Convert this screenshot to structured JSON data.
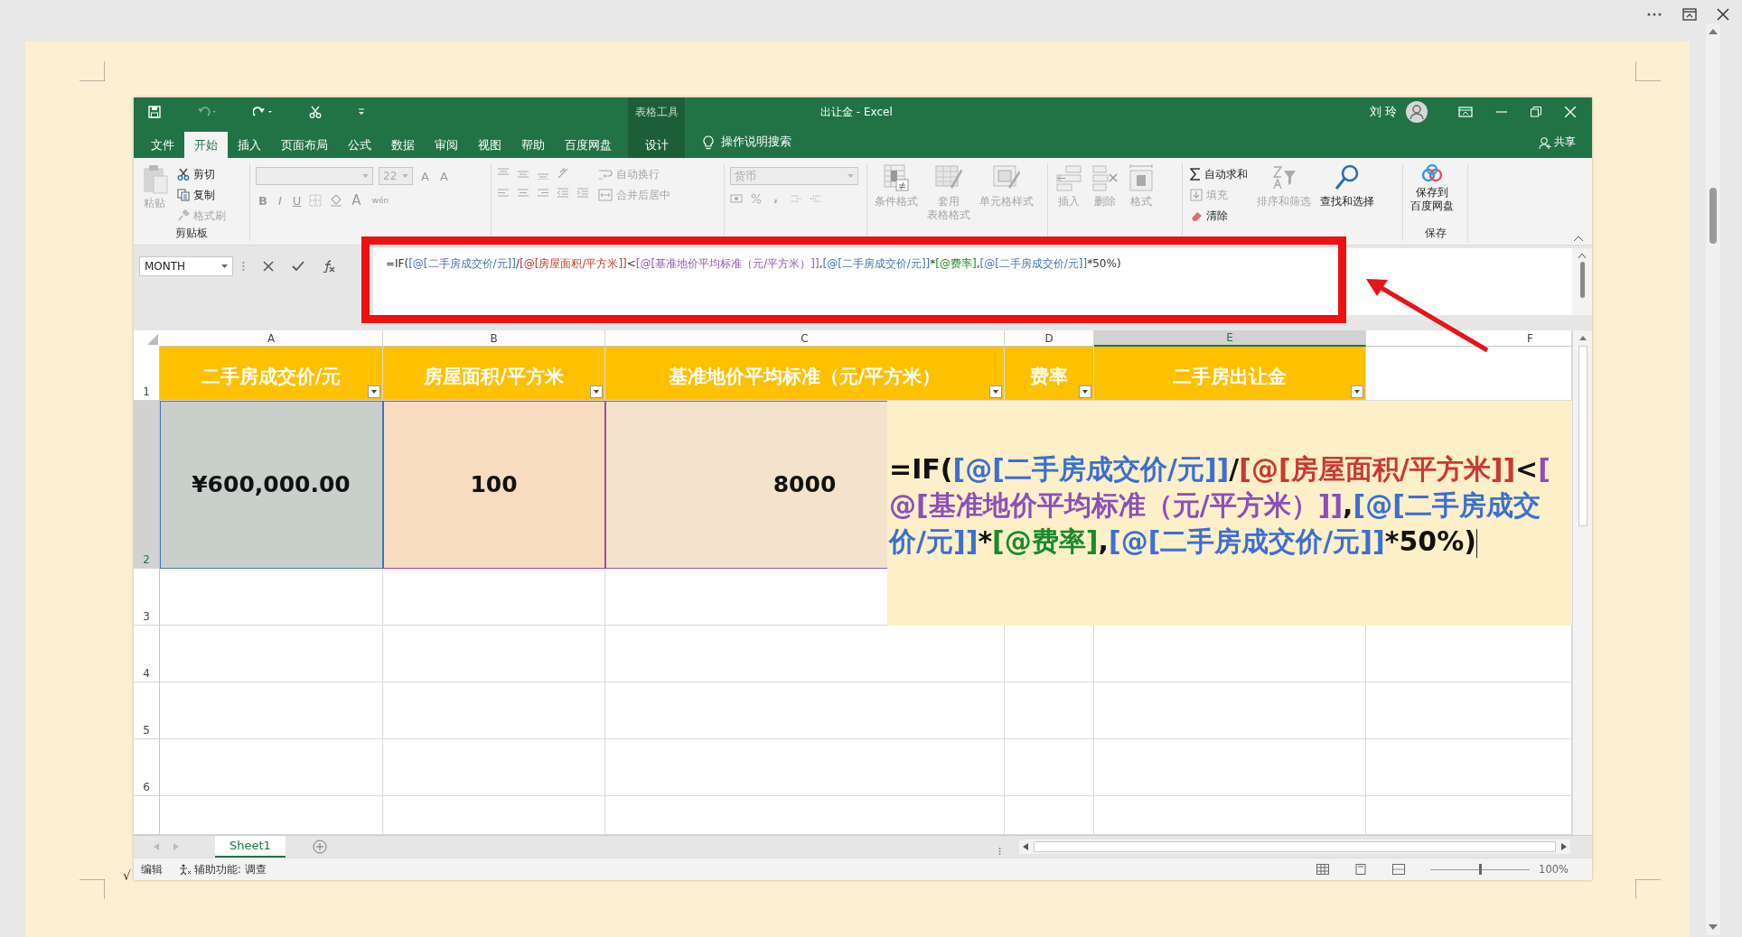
{
  "page": {
    "margin_mark": "√"
  },
  "excel": {
    "contextual_label": "表格工具",
    "title": "出让金 - Excel",
    "user": "刘 玲",
    "tabs": [
      {
        "label": "文件",
        "selected": false,
        "contextual": false
      },
      {
        "label": "开始",
        "selected": true,
        "contextual": false
      },
      {
        "label": "插入",
        "selected": false,
        "contextual": false
      },
      {
        "label": "页面布局",
        "selected": false,
        "contextual": false
      },
      {
        "label": "公式",
        "selected": false,
        "contextual": false
      },
      {
        "label": "数据",
        "selected": false,
        "contextual": false
      },
      {
        "label": "审阅",
        "selected": false,
        "contextual": false
      },
      {
        "label": "视图",
        "selected": false,
        "contextual": false
      },
      {
        "label": "帮助",
        "selected": false,
        "contextual": false
      },
      {
        "label": "百度网盘",
        "selected": false,
        "contextual": false
      },
      {
        "label": "设计",
        "selected": false,
        "contextual": true
      }
    ],
    "tell_me": "操作说明搜索",
    "share": "共享",
    "ribbon": {
      "groups": [
        {
          "kind": "clipboard",
          "label": "剪贴板",
          "items": [
            {
              "kind": "large",
              "lines": [
                "粘贴"
              ],
              "disabled": true
            },
            {
              "kind": "small",
              "label": "剪切",
              "disabled": false
            },
            {
              "kind": "small",
              "label": "复制",
              "disabled": false
            },
            {
              "kind": "small",
              "label": "格式刷",
              "disabled": true
            }
          ]
        },
        {
          "kind": "font",
          "size": "22",
          "format_buttons": [
            "B",
            "I",
            "U"
          ],
          "grow_buttons": [
            "A",
            "A"
          ],
          "color_button": "A",
          "phonetic": "wén"
        },
        {
          "kind": "alignment",
          "items": [
            {
              "kind": "small",
              "label": "自动换行",
              "disabled": true
            },
            {
              "kind": "small",
              "label": "合并后居中",
              "disabled": true
            }
          ]
        },
        {
          "kind": "number",
          "format": "货币"
        },
        {
          "kind": "styles",
          "items": [
            {
              "kind": "large",
              "lines": [
                "条件格式"
              ],
              "disabled": true
            },
            {
              "kind": "large",
              "lines": [
                "套用",
                "表格格式"
              ],
              "disabled": true
            },
            {
              "kind": "large",
              "lines": [
                "单元格样式"
              ],
              "disabled": true
            }
          ]
        },
        {
          "kind": "cells",
          "items": [
            {
              "kind": "large",
              "lines": [
                "插入"
              ],
              "disabled": true
            },
            {
              "kind": "large",
              "lines": [
                "删除"
              ],
              "disabled": true
            },
            {
              "kind": "large",
              "lines": [
                "格式"
              ],
              "disabled": true
            }
          ]
        },
        {
          "kind": "editing",
          "items": [
            {
              "kind": "small",
              "label": "自动求和",
              "disabled": false
            },
            {
              "kind": "small",
              "label": "填充",
              "disabled": true
            },
            {
              "kind": "small",
              "label": "清除",
              "disabled": false
            },
            {
              "kind": "large",
              "lines": [
                "排序和筛选"
              ],
              "disabled": true
            },
            {
              "kind": "large",
              "lines": [
                "查找和选择"
              ],
              "disabled": false
            }
          ]
        },
        {
          "kind": "save",
          "label": "保存",
          "items": [
            {
              "kind": "large",
              "lines": [
                "保存到",
                "百度网盘"
              ],
              "disabled": false
            }
          ]
        }
      ]
    },
    "formula_bar": {
      "name_box": "MONTH",
      "segments": [
        {
          "text": "=IF("
        },
        {
          "text": "[@[二手房成交价/元]]",
          "color": "#4472c4"
        },
        {
          "text": "/"
        },
        {
          "text": "[@[房屋面积/平方米]]",
          "color": "#c0392b"
        },
        {
          "text": "<"
        },
        {
          "text": "[@[基准地价平均标准（元/平方米）]]",
          "color": "#8e5bb5"
        },
        {
          "text": ","
        },
        {
          "text": "[@[二手房成交价/元]]",
          "color": "#4472c4"
        },
        {
          "text": "*"
        },
        {
          "text": "[@费率]",
          "color": "#1f8a2e"
        },
        {
          "text": ","
        },
        {
          "text": "[@[二手房成交价/元]]",
          "color": "#4472c4"
        },
        {
          "text": "*50%)"
        }
      ]
    },
    "sheet": {
      "columns": [
        {
          "label": "A",
          "selected": false
        },
        {
          "label": "B",
          "selected": false
        },
        {
          "label": "C",
          "selected": false
        },
        {
          "label": "D",
          "selected": false
        },
        {
          "label": "E",
          "selected": true
        },
        {
          "label": "F",
          "selected": false
        }
      ],
      "rows": [
        {
          "label": "1",
          "kind": "header",
          "selected": false,
          "cells": [
            {
              "kind": "header",
              "text": "二手房成交价/元"
            },
            {
              "kind": "header",
              "text": "房屋面积/平方米"
            },
            {
              "kind": "header",
              "text": "基准地价平均标准（元/平方米）"
            },
            {
              "kind": "header",
              "text": "费率"
            },
            {
              "kind": "header",
              "text": "二手房出让金"
            },
            {
              "kind": "empty"
            }
          ]
        },
        {
          "label": "2",
          "kind": "data",
          "selected": true,
          "cells": [
            {
              "kind": "value",
              "text": "¥600,000.00",
              "color": "#c9d0cb",
              "outline": {
                "color": "#4472c4"
              }
            },
            {
              "kind": "value",
              "text": "100",
              "color": "#f8dcc0",
              "outline": {
                "color": "#b0408a"
              }
            },
            {
              "kind": "value",
              "text": "8000",
              "color": "#f3e2cc",
              "outline": {
                "color": "#8e5bb5"
              }
            }
          ]
        },
        {
          "label": "3",
          "kind": "blank",
          "selected": false,
          "cells": []
        },
        {
          "label": "4",
          "kind": "blank",
          "selected": false,
          "cells": []
        },
        {
          "label": "5",
          "kind": "blank",
          "selected": false,
          "cells": []
        },
        {
          "label": "6",
          "kind": "blank",
          "selected": false,
          "cells": []
        }
      ]
    },
    "cell_editor": {
      "segments": [
        {
          "text": "=IF("
        },
        {
          "text": "[@[二手房成交价/元]]",
          "color": "#3b6fd1"
        },
        {
          "text": "/"
        },
        {
          "text": "[@[房屋面积/平方米]]",
          "color": "#c83a32"
        },
        {
          "text": "<"
        },
        {
          "text": "[@[基准地价平均标准（元/平方米）]]",
          "color": "#8b50b8"
        },
        {
          "text": ","
        },
        {
          "text": "[@[二手房成交价/元]]",
          "color": "#3b6fd1"
        },
        {
          "text": "*"
        },
        {
          "text": "[@费率]",
          "color": "#1a8a2c"
        },
        {
          "text": ","
        },
        {
          "text": "[@[二手房成交价/元]]",
          "color": "#3b6fd1"
        },
        {
          "text": "*50%)"
        }
      ]
    },
    "sheet_tabs": [
      {
        "label": "Sheet1",
        "selected": true
      }
    ],
    "status": {
      "mode": "编辑",
      "accessibility": "辅助功能: 调查",
      "zoom_slider": {
        "level": 0.5
      },
      "zoom": "100%"
    }
  }
}
